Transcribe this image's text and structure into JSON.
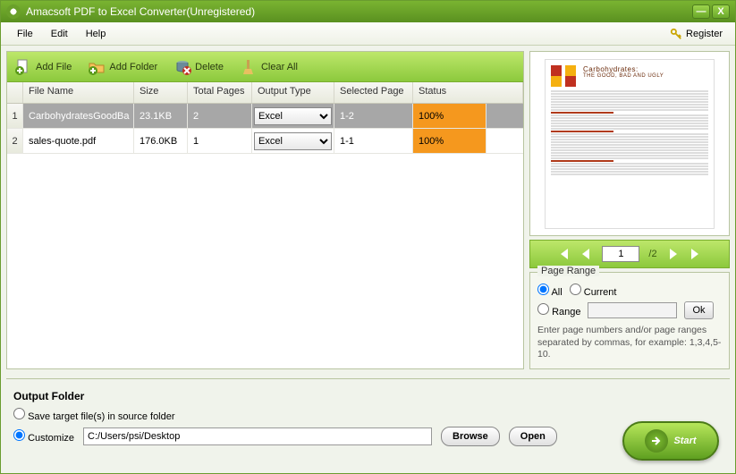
{
  "window": {
    "title": "Amacsoft PDF to Excel Converter(Unregistered)"
  },
  "menu": {
    "file": "File",
    "edit": "Edit",
    "help": "Help",
    "register": "Register"
  },
  "toolbar": {
    "add_file": "Add File",
    "add_folder": "Add Folder",
    "delete": "Delete",
    "clear_all": "Clear All"
  },
  "table": {
    "headers": {
      "file_name": "File Name",
      "size": "Size",
      "total_pages": "Total Pages",
      "output_type": "Output Type",
      "selected_page": "Selected Page",
      "status": "Status"
    },
    "rows": [
      {
        "num": "1",
        "file_name": "CarbohydratesGoodBa",
        "size": "23.1KB",
        "total_pages": "2",
        "output_type": "Excel",
        "selected_page": "1-2",
        "status": "100%",
        "selected": true
      },
      {
        "num": "2",
        "file_name": "sales-quote.pdf",
        "size": "176.0KB",
        "total_pages": "1",
        "output_type": "Excel",
        "selected_page": "1-1",
        "status": "100%",
        "selected": false
      }
    ]
  },
  "preview": {
    "title_line1": "Carbohydrates:",
    "title_line2": "THE GOOD, BAD AND UGLY"
  },
  "pager": {
    "current": "1",
    "total": "/2"
  },
  "range": {
    "legend": "Page Range",
    "all": "All",
    "current": "Current",
    "range": "Range",
    "ok": "Ok",
    "hint": "Enter page numbers and/or page ranges separated by commas, for example: 1,3,4,5-10."
  },
  "output": {
    "heading": "Output Folder",
    "save_source": "Save target file(s) in source folder",
    "customize": "Customize",
    "path": "C:/Users/psi/Desktop",
    "browse": "Browse",
    "open": "Open"
  },
  "start": "Start"
}
